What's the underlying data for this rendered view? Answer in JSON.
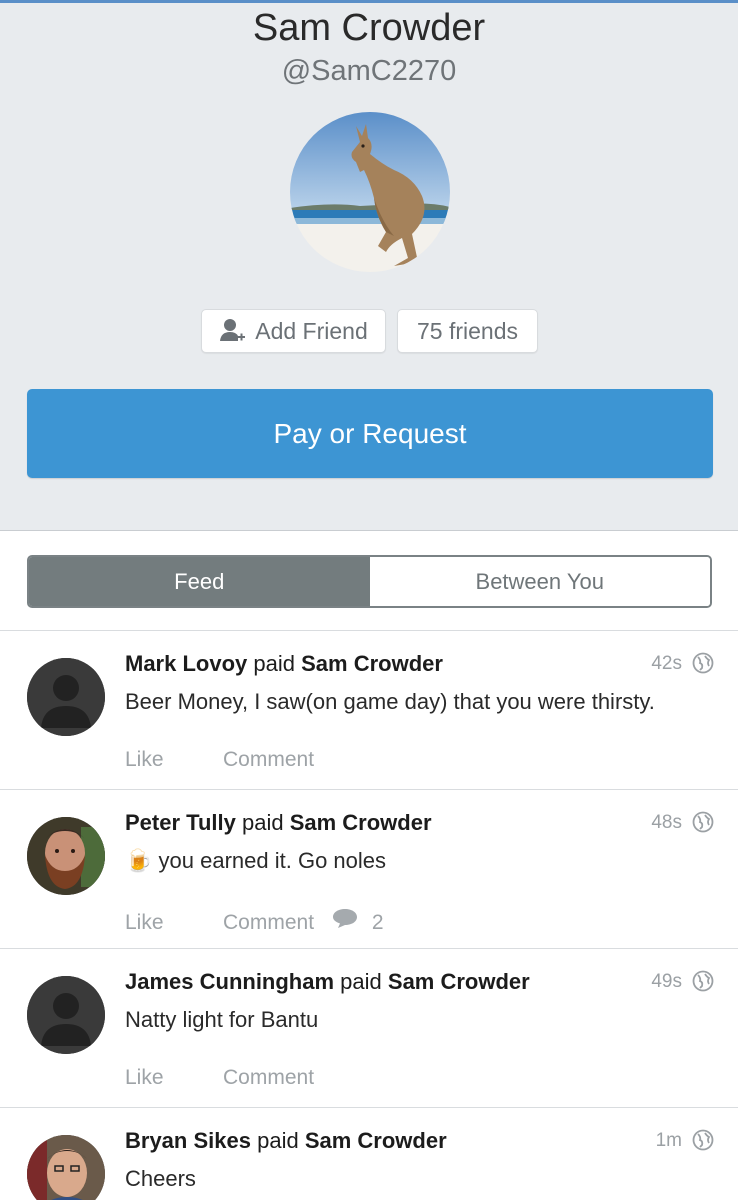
{
  "profile": {
    "name": "Sam Crowder",
    "handle": "@SamC2270",
    "avatar_icon": "kangaroo-photo",
    "add_friend_label": "Add Friend",
    "friends_count_label": "75 friends",
    "pay_button_label": "Pay or Request"
  },
  "tabs": [
    {
      "label": "Feed",
      "active": true
    },
    {
      "label": "Between You",
      "active": false
    }
  ],
  "feed": [
    {
      "payer": "Mark Lovoy",
      "verb": "paid",
      "payee": "Sam Crowder",
      "time": "42s",
      "message": "Beer Money, I saw(on game day) that you were thirsty.",
      "like_label": "Like",
      "comment_label": "Comment",
      "comment_count": "",
      "avatar": "default-silhouette"
    },
    {
      "payer": "Peter Tully",
      "verb": "paid",
      "payee": "Sam Crowder",
      "time": "48s",
      "emoji": "🍺",
      "message": "you earned it. Go noles",
      "like_label": "Like",
      "comment_label": "Comment",
      "comment_count": "2",
      "avatar": "bearded-man-photo"
    },
    {
      "payer": "James Cunningham",
      "verb": "paid",
      "payee": "Sam Crowder",
      "time": "49s",
      "message": "Natty light for Bantu",
      "like_label": "Like",
      "comment_label": "Comment",
      "comment_count": "",
      "avatar": "default-silhouette"
    },
    {
      "payer": "Bryan Sikes",
      "verb": "paid",
      "payee": "Sam Crowder",
      "time": "1m",
      "message": "Cheers",
      "avatar": "man-photo"
    }
  ],
  "colors": {
    "accent": "#3d95d3",
    "tab_active": "#737c7e",
    "profile_bg": "#e8ebee"
  }
}
